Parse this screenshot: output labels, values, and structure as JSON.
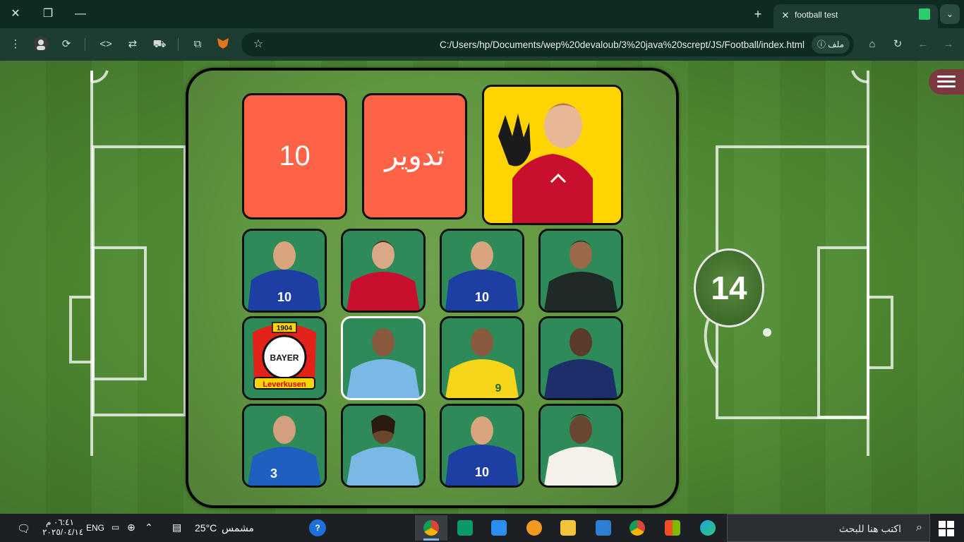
{
  "browser": {
    "tab_title": "football test",
    "url": "C:/Users/hp/Documents/wep%20devaloub/3%20java%20scrept/JS/Football/index.html",
    "site_chip": "ملف"
  },
  "game": {
    "counter_value": "10",
    "shuffle_label": "تدوير",
    "score": "14"
  },
  "taskbar": {
    "search_placeholder": "اكتب هنا للبحث",
    "weather_temp": "25°C",
    "weather_desc": "مشمس",
    "language": "ENG",
    "time": "٠٦:٤١ م",
    "date": "٢٠٢٥/٠٤/١٤"
  },
  "colors": {
    "accent": "#ff6347",
    "board_border": "#050505",
    "menu_button": "#7a3a3f"
  }
}
